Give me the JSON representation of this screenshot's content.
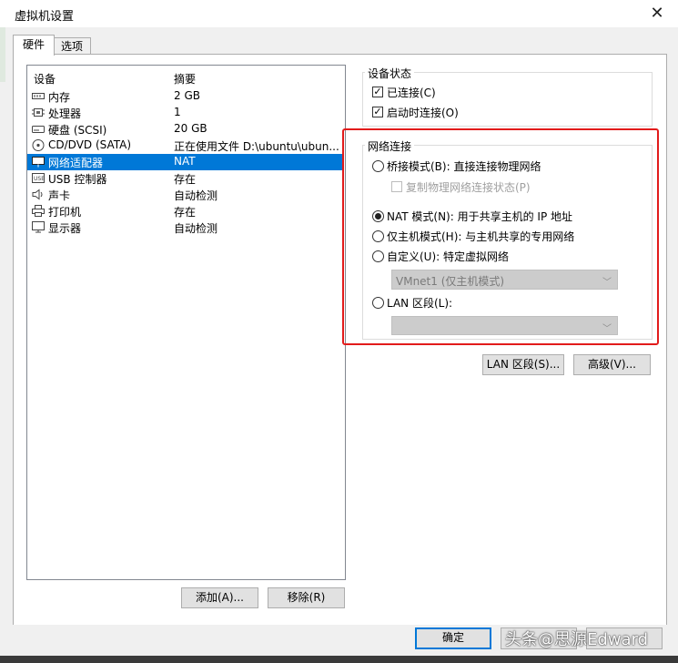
{
  "window": {
    "title": "虚拟机设置",
    "close_glyph": "✕"
  },
  "tabs": [
    "硬件",
    "选项"
  ],
  "device_list": {
    "headers": {
      "device": "设备",
      "summary": "摘要"
    },
    "rows": [
      {
        "name": "内存",
        "summary": "2 GB",
        "icon": "memory-icon"
      },
      {
        "name": "处理器",
        "summary": "1",
        "icon": "processor-icon"
      },
      {
        "name": "硬盘 (SCSI)",
        "summary": "20 GB",
        "icon": "harddisk-icon"
      },
      {
        "name": "CD/DVD (SATA)",
        "summary": "正在使用文件 D:\\ubuntu\\ubun...",
        "icon": "cdrom-icon"
      },
      {
        "name": "网络适配器",
        "summary": "NAT",
        "icon": "network-adapter-icon",
        "selected": true
      },
      {
        "name": "USB 控制器",
        "summary": "存在",
        "icon": "usb-icon"
      },
      {
        "name": "声卡",
        "summary": "自动检测",
        "icon": "sound-icon"
      },
      {
        "name": "打印机",
        "summary": "存在",
        "icon": "printer-icon"
      },
      {
        "name": "显示器",
        "summary": "自动检测",
        "icon": "display-icon"
      }
    ]
  },
  "left_buttons": {
    "add": "添加(A)...",
    "remove": "移除(R)"
  },
  "device_status": {
    "title": "设备状态",
    "connected": {
      "label": "已连接(C)",
      "checked": true
    },
    "connect_at_power_on": {
      "label": "启动时连接(O)",
      "checked": true
    }
  },
  "network_connection": {
    "title": "网络连接",
    "bridged": "桥接模式(B): 直接连接物理网络",
    "replicate": "复制物理网络连接状态(P)",
    "nat": "NAT 模式(N): 用于共享主机的 IP 地址",
    "host_only": "仅主机模式(H): 与主机共享的专用网络",
    "custom": "自定义(U): 特定虚拟网络",
    "custom_select_value": "VMnet1 (仅主机模式)",
    "lan_segment": "LAN 区段(L):",
    "lan_select_value": "",
    "selected": "nat"
  },
  "right_buttons": {
    "lan_segments": "LAN 区段(S)...",
    "advanced": "高级(V)..."
  },
  "footer_buttons": {
    "ok": "确定"
  },
  "watermark": "头条@思源Edward",
  "colors": {
    "selection": "#0078d7",
    "highlight_box": "#e21b1b"
  }
}
